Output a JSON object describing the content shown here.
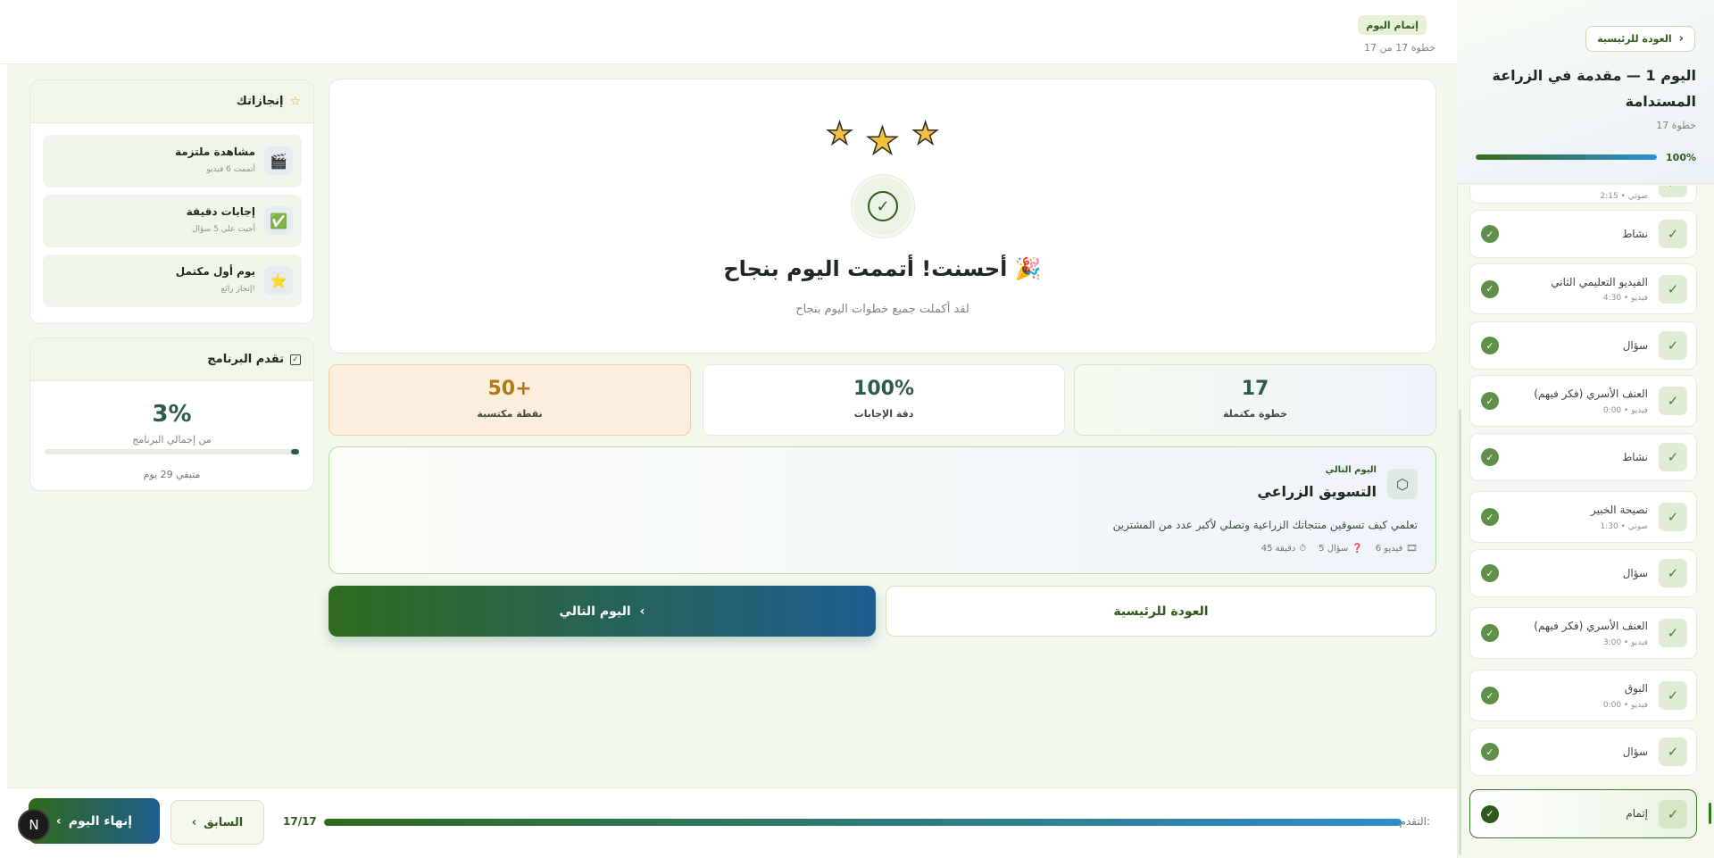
{
  "sidebar": {
    "back_label": "العودة للرئيسية",
    "title": "اليوم 1 — مقدمة في الزراعة المستدامة",
    "step_count": "17 خطوة",
    "progress_text": "100%",
    "progress": 1.0,
    "partial_top_sub": "صوتي • 2:15",
    "steps": [
      {
        "title": "نشاط",
        "sub": ""
      },
      {
        "title": "الفيديو التعليمي الثاني",
        "sub": "فيديو • 4:30"
      },
      {
        "title": "سؤال",
        "sub": ""
      },
      {
        "title": "العنف الأسري (فكر فيهم)",
        "sub": "فيديو • 0:00"
      },
      {
        "title": "نشاط",
        "sub": ""
      },
      {
        "title": "نصيحة الخبير",
        "sub": "صوتي • 1:30"
      },
      {
        "title": "سؤال",
        "sub": ""
      },
      {
        "title": "العنف الأسري (فكر فيهم)",
        "sub": "فيديو • 3:00"
      },
      {
        "title": "البوق",
        "sub": "فيديو • 0:00"
      },
      {
        "title": "سؤال",
        "sub": ""
      },
      {
        "title": "إتمام",
        "sub": ""
      }
    ]
  },
  "header": {
    "badge": "إتمام اليوم",
    "step_of": "خطوة 17 من 17"
  },
  "hero": {
    "title": "أحسنت! أتممت اليوم بنجاح",
    "emoji": "🎉",
    "subtitle": "لقد أكملت جميع خطوات اليوم بنجاح"
  },
  "stats": [
    {
      "value": "17",
      "label": "خطوة مكتملة",
      "color": "#2c5b4b"
    },
    {
      "value": "100%",
      "label": "دقة الإجابات",
      "color": "#2c5b4b"
    },
    {
      "value": "50+",
      "label": "نقطة مكتسبة",
      "color": "#b07a12"
    }
  ],
  "next_day": {
    "eyebrow": "اليوم التالي",
    "title": "التسويق الزراعي",
    "description": "تعلمي كيف تسوقين منتجاتك الزراعية وتصلي لأكبر عدد من المشترين",
    "meta": [
      {
        "icon": "🎞",
        "text": "6 فيديو"
      },
      {
        "icon": "❓",
        "text": "5 سؤال"
      },
      {
        "icon": "⏱",
        "text": "45 دقيقة"
      }
    ]
  },
  "buttons": {
    "home": "العودة للرئيسية",
    "next_day": "اليوم التالي"
  },
  "achievements": {
    "title": "إنجازاتك",
    "items": [
      {
        "icon": "🎬",
        "title": "مشاهدة ملتزمة",
        "sub": "أتممت 6 فيديو"
      },
      {
        "icon": "✅",
        "title": "إجابات دقيقة",
        "sub": "أجبت على 5 سؤال"
      },
      {
        "icon": "⭐",
        "title": "يوم أول مكتمل",
        "sub": "إنجاز رائع!"
      }
    ]
  },
  "program": {
    "title": "تقدم البرنامج",
    "percent": "3%",
    "label": "من إجمالي البرنامج",
    "progress": 0.03,
    "remaining": "متبقي 29 يوم"
  },
  "bottom": {
    "progress_label": "التقدم:",
    "count": "17/17",
    "progress": 1.0,
    "prev": "السابق",
    "finish": "إنهاء اليوم"
  },
  "avatar_letter": "N",
  "colors": {
    "brand_green": "#2f5a1c",
    "brand_blue": "#1f5c8f",
    "accent_orange": "#b07a12"
  }
}
